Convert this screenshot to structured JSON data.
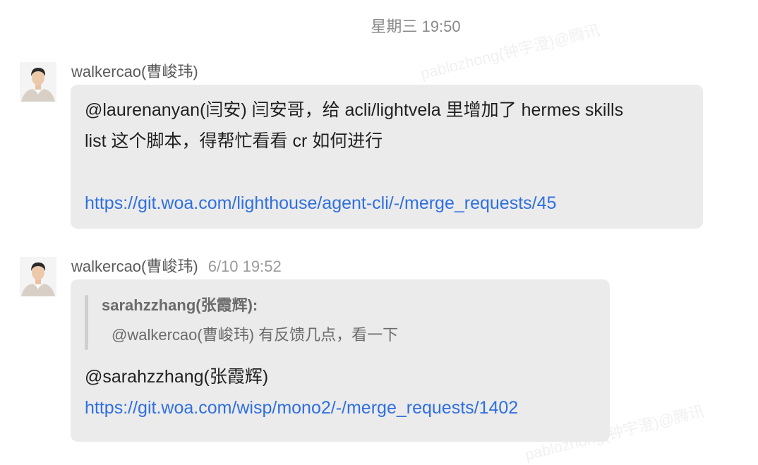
{
  "header": {
    "timestamp": "星期三 19:50"
  },
  "watermark": "pablozhong(钟宇澄)@腾讯",
  "messages": [
    {
      "sender": "walkercao(曹峻玮)",
      "text_line1": "@laurenanyan(闫安) 闫安哥，给 acli/lightvela 里增加了 hermes skills",
      "text_line2": "list 这个脚本，得帮忙看看 cr 如何进行",
      "link": "https://git.woa.com/lighthouse/agent-cli/-/merge_requests/45"
    },
    {
      "sender": "walkercao(曹峻玮)",
      "time": "6/10 19:52",
      "quote_author": "sarahzzhang(张霞辉):",
      "quote_text": "@walkercao(曹峻玮) 有反馈几点，看一下",
      "mention": "@sarahzzhang(张霞辉)",
      "link": "https://git.woa.com/wisp/mono2/-/merge_requests/1402"
    }
  ],
  "colors": {
    "link": "#2f6fe0",
    "bubble": "#ebebeb"
  },
  "icons": {
    "avatar": "user-avatar-photo"
  }
}
